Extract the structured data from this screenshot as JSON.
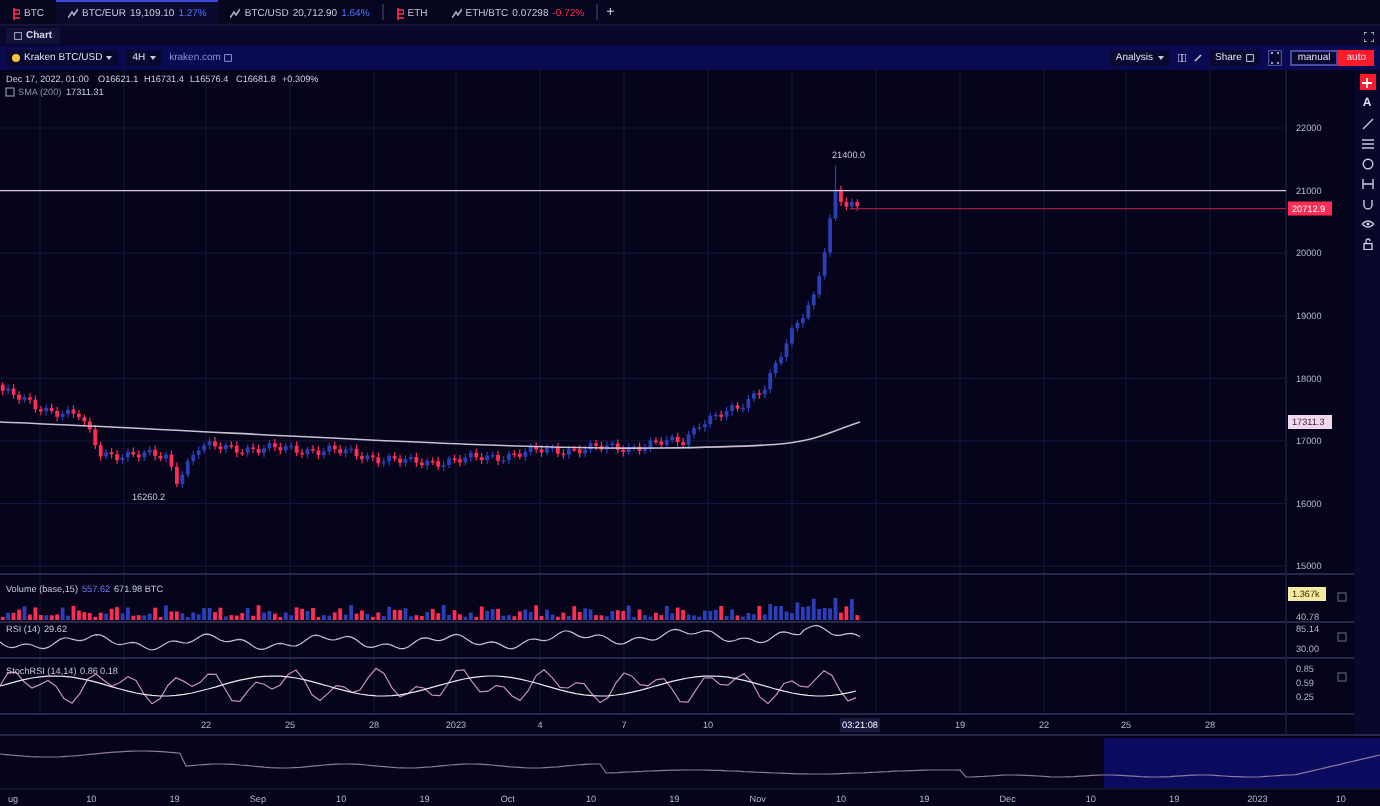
{
  "tabs": [
    {
      "kind": "group",
      "label": "BTC",
      "selected": false
    },
    {
      "kind": "pair",
      "label": "BTC/EUR",
      "price": "19,109.10",
      "change": "1.27%",
      "up": true,
      "selected": true
    },
    {
      "kind": "pair",
      "label": "BTC/USD",
      "price": "20,712.90",
      "change": "1.64%",
      "up": true,
      "selected": false
    },
    {
      "kind": "group",
      "label": "ETH",
      "selected": false
    },
    {
      "kind": "pair",
      "label": "ETH/BTC",
      "price": "0.07298",
      "change": "-0.72%",
      "up": false,
      "selected": false
    }
  ],
  "add_tab": "+",
  "panel_title": "Chart",
  "toolbar": {
    "symbol": "Kraken BTC/USD",
    "interval": "4H",
    "source_link": "kraken.com",
    "analysis": "Analysis",
    "share": "Share",
    "modes": [
      {
        "label": "manual",
        "selected": false
      },
      {
        "label": "auto",
        "selected": true
      }
    ]
  },
  "legend": {
    "date": "Dec 17, 2022, 01:00",
    "open": "O16621.1",
    "high": "H16731.4",
    "low": "L16576.4",
    "close": "C16681.8",
    "change": "+0.309%",
    "sma": "SMA (200)",
    "sma_value": "17311.31"
  },
  "price_axis": [
    "22000",
    "21000",
    "20000",
    "19000",
    "18000",
    "17000",
    "16000",
    "15000"
  ],
  "price_labels": {
    "last": "20712.9",
    "sma": "17311.3",
    "high": "21400.0",
    "low": "16260.2"
  },
  "volume": {
    "title": "Volume (base,15)",
    "value_1": "557.62",
    "value_2": "671.98 BTC",
    "axis": [
      "1.367k",
      "40.78"
    ]
  },
  "rsi": {
    "title": "RSI (14)",
    "value": "29.62",
    "axis": [
      "85.14",
      "30.00"
    ]
  },
  "stoch": {
    "title": "StochRSI (14,14)",
    "value_1": "0.86",
    "value_2": "0.18",
    "axis": [
      "0.85",
      "0.59",
      "0.25"
    ]
  },
  "time_axis": [
    "22",
    "25",
    "28",
    "2023",
    "4",
    "7",
    "10",
    "03:21:08",
    "19",
    "22",
    "25",
    "28"
  ],
  "text_tool": "A",
  "navigator_axis": [
    "ug",
    "10",
    "19",
    "Sep",
    "10",
    "19",
    "Oct",
    "10",
    "19",
    "Nov",
    "10",
    "19",
    "Dec",
    "10",
    "19",
    "2023",
    "10"
  ]
}
